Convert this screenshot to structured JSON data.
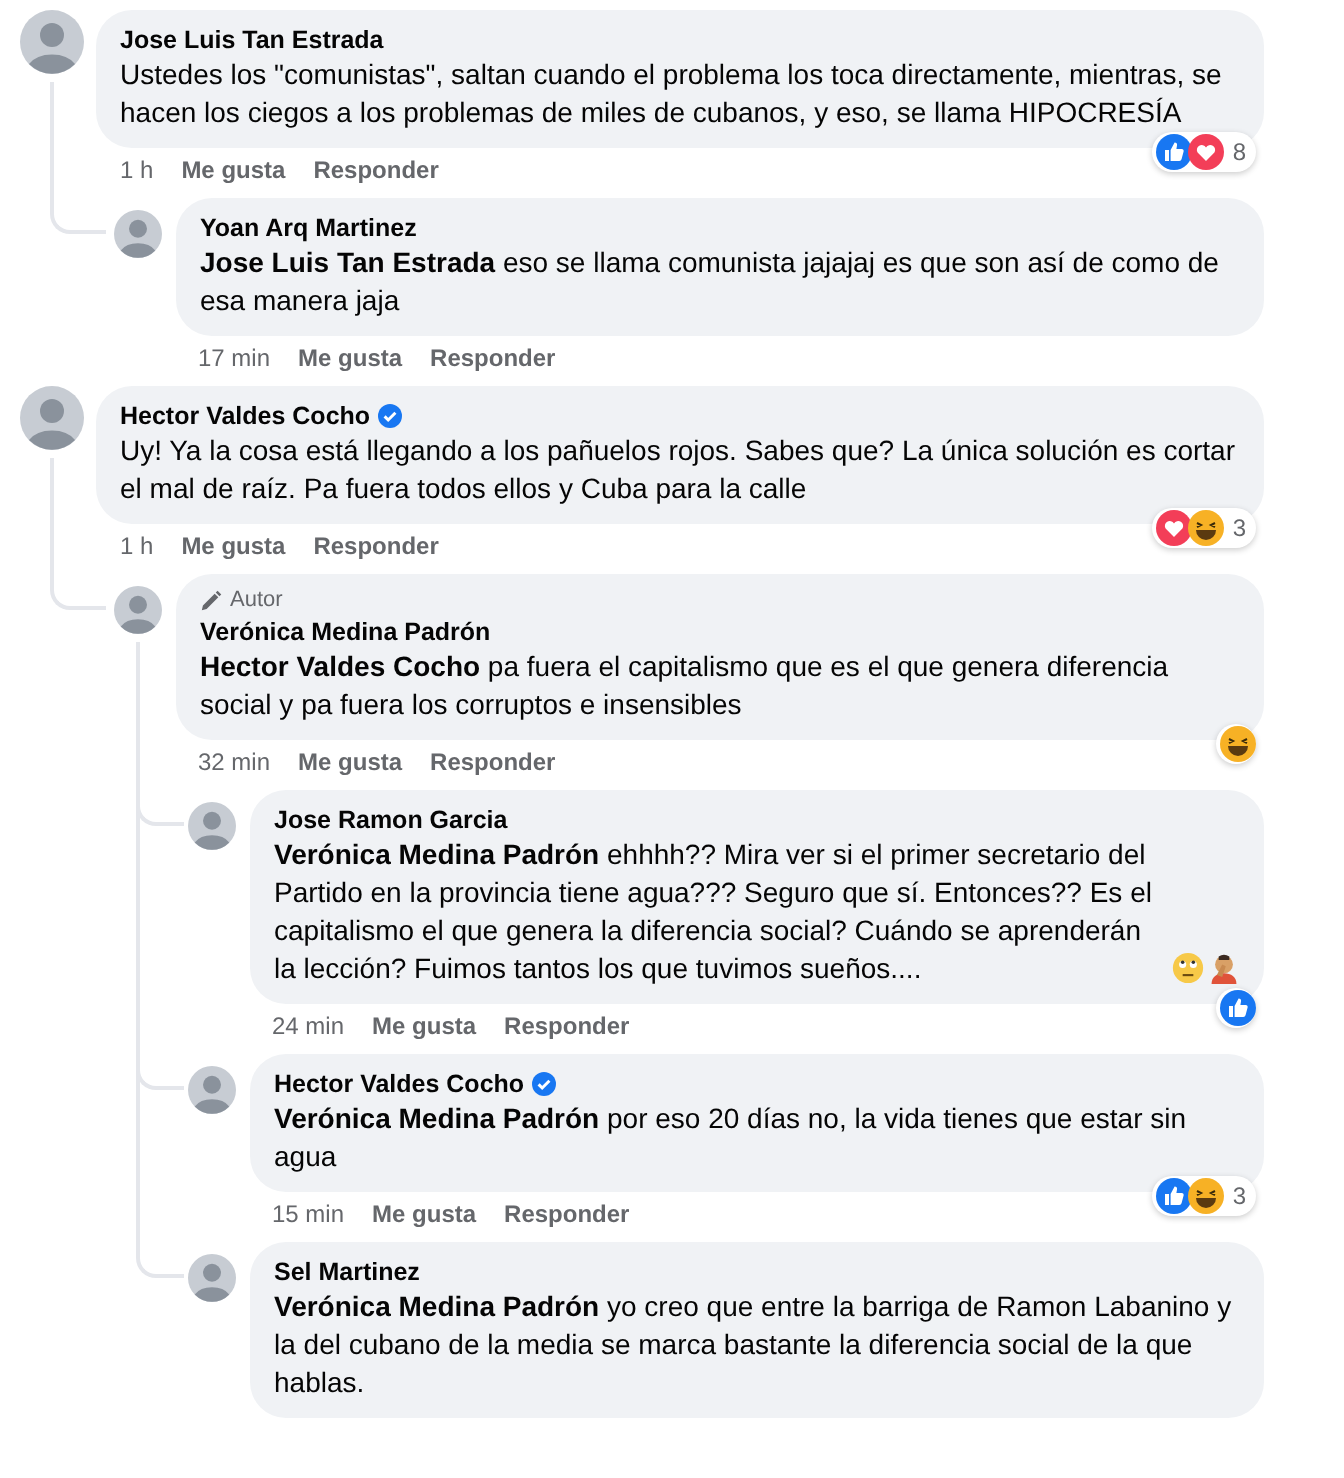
{
  "comments": [
    {
      "author": "Jose Luis Tan Estrada",
      "text": "Ustedes los \"comunistas\", saltan cuando el problema los toca directamente, mientras, se hacen los ciegos a los problemas de miles de cubanos, y eso, se llama HIPOCRESÍA",
      "time": "1 h",
      "actions": [
        "Me gusta",
        "Responder"
      ],
      "reactions": {
        "icons": [
          {
            "kind": "like"
          },
          {
            "kind": "love"
          }
        ],
        "count": "8"
      },
      "replies": [
        {
          "author": "Yoan Arq Martinez",
          "text": "**Jose Luis Tan Estrada** eso se llama comunista jajajaj es que son así de como de esa manera jaja",
          "time": "17 min",
          "actions": [
            "Me gusta",
            "Responder"
          ]
        }
      ]
    },
    {
      "author": "Hector Valdes Cocho",
      "verified": true,
      "text": "Uy! Ya la cosa está llegando a los pañuelos rojos. Sabes que? La única solución es cortar el mal de raíz. Pa fuera todos ellos y Cuba para la calle",
      "time": "1 h",
      "actions": [
        "Me gusta",
        "Responder"
      ],
      "reactions": {
        "icons": [
          {
            "kind": "love"
          },
          {
            "kind": "haha"
          }
        ],
        "count": "3"
      },
      "replies": [
        {
          "author": "Verónica Medina Padrón",
          "author_badge": "Autor",
          "text": "**Hector Valdes Cocho** pa fuera el capitalismo que es el que genera diferencia social y pa fuera los corruptos e insensibles",
          "time": "32 min",
          "actions": [
            "Me gusta",
            "Responder"
          ],
          "reactions": {
            "icons": [
              {
                "kind": "haha"
              }
            ]
          },
          "replies": [
            {
              "author": "Jose Ramon Garcia",
              "text": "**Verónica Medina Padrón** ehhhh?? Mira ver si el primer secretario del Partido en la provincia tiene agua??? Seguro que sí. Entonces?? Es el capitalismo el que genera la diferencia social? Cuándo se aprenderán la lección? Fuimos tantos los que tuvimos sueños....",
              "emojis": [
                {
                  "kind": "eye_roll"
                },
                {
                  "kind": "facepalm"
                }
              ],
              "time": "24 min",
              "actions": [
                "Me gusta",
                "Responder"
              ],
              "reactions": {
                "icons": [
                  {
                    "kind": "like"
                  }
                ]
              }
            },
            {
              "author": "Hector Valdes Cocho",
              "verified": true,
              "text": "**Verónica Medina Padrón** por eso 20 días no, la vida tienes que estar sin agua",
              "time": "15 min",
              "actions": [
                "Me gusta",
                "Responder"
              ],
              "reactions": {
                "icons": [
                  {
                    "kind": "like"
                  },
                  {
                    "kind": "haha"
                  }
                ],
                "count": "3"
              }
            },
            {
              "author": "Sel Martinez",
              "text": "**Verónica Medina Padrón** yo creo que entre la barriga de Ramon Labanino y la del cubano de la media se marca bastante la diferencia social de la que hablas."
            }
          ]
        }
      ]
    }
  ]
}
